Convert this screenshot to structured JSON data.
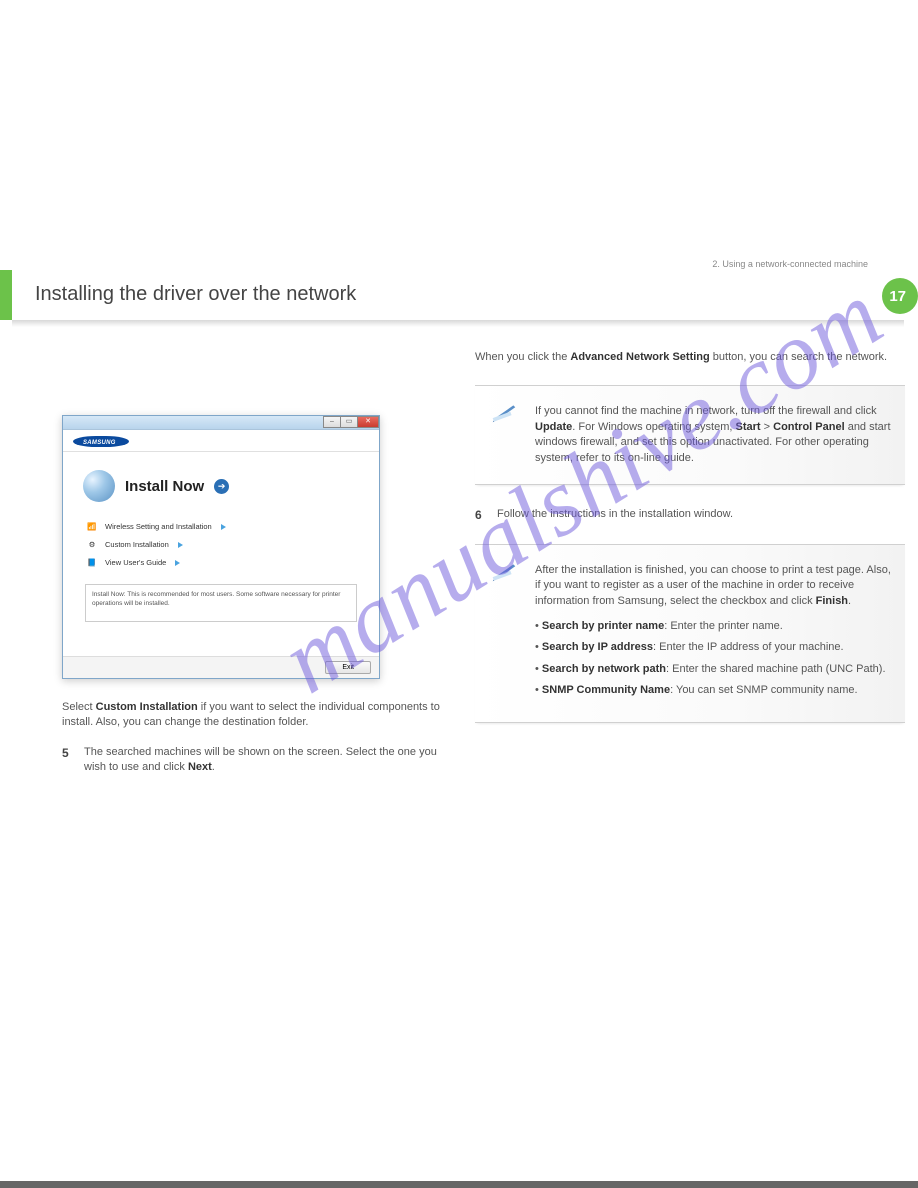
{
  "header": {
    "title": "Installing the driver over the network",
    "section_label": "2. Using a network-connected machine",
    "page_number": "17"
  },
  "installer": {
    "brand": "SAMSUNG",
    "install_now": "Install Now",
    "wireless": "Wireless Setting and Installation",
    "custom": "Custom Installation",
    "view_guide": "View User's Guide",
    "description": "Install Now: This is recommended for most users. Some software necessary for printer operations will be installed.",
    "exit_label": "Exit"
  },
  "left": {
    "para1_a": "Select ",
    "para1_b": "Custom Installation",
    "para1_c": " if you want to select the individual components to install. Also, you can change the destination folder.",
    "step5_num": "5",
    "step5_a": "The searched machines will be shown on the screen. Select the one you wish to use and click ",
    "step5_b": "Next",
    "step5_c": "."
  },
  "right": {
    "para_a": "When you click the ",
    "para_b": "Advanced Network Setting",
    "para_c": " button, you can search the network.",
    "note1_a": "If you cannot find the machine in network, turn off the firewall and click ",
    "note1_b": "Update",
    "note1_c": ". For Windows operating system, ",
    "note1_d": "Start",
    "note1_e": " > ",
    "note1_f": "Control Panel",
    "note1_g": " and start windows firewall, and set this option unactivated. For other operating system, refer to its on-line guide.",
    "step6_num": "6",
    "step6": "Follow the instructions in the installation window.",
    "note2_intro": "After the installation is finished, you can choose to print a test page. Also, if you want to register as a user of the machine in order to receive information from Samsung, select the checkbox and click ",
    "note2_finish": "Finish",
    "bullets": {
      "b1_a": "Search by printer name",
      "b1_b": ": Enter the printer name.",
      "b2_a": "Search by IP address",
      "b2_b": ": Enter the IP address of your machine.",
      "b3_a": "Search by network path",
      "b3_b": ": Enter the shared machine path (UNC Path).",
      "b4_a": "SNMP Community Name",
      "b4_b": ": You can set SNMP community name."
    }
  }
}
